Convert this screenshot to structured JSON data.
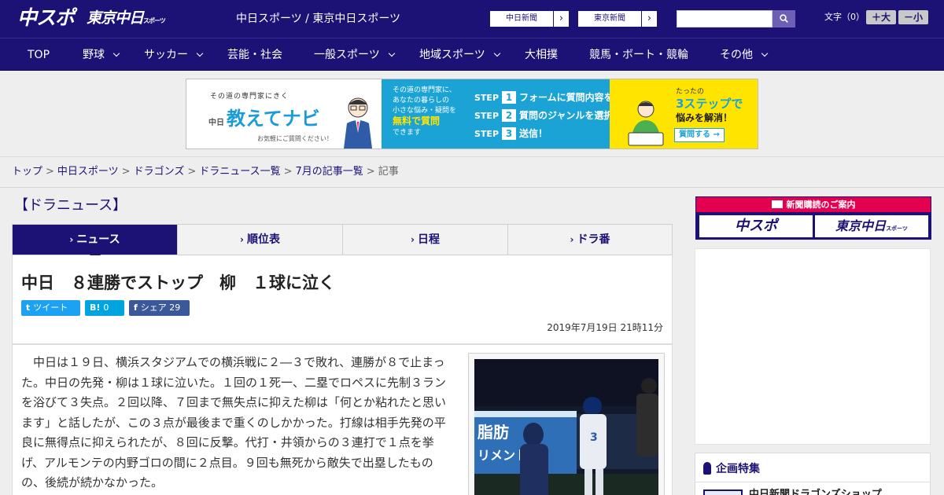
{
  "header": {
    "logo_main": "中スポ",
    "logo_tokyo": "東京中日",
    "logo_tokyo_suffix": "スポーツ",
    "site_caption": "中日スポーツ / 東京中日スポーツ",
    "paper_links": [
      "中日新聞",
      "東京新聞"
    ],
    "search_placeholder": "",
    "font_size_label": "文字（0）",
    "font_larger": "＋大",
    "font_smaller": "－小"
  },
  "nav": {
    "items": [
      {
        "label": "TOP",
        "dropdown": false
      },
      {
        "label": "野球",
        "dropdown": true
      },
      {
        "label": "サッカー",
        "dropdown": true
      },
      {
        "label": "芸能・社会",
        "dropdown": false
      },
      {
        "label": "一般スポーツ",
        "dropdown": true
      },
      {
        "label": "地域スポーツ",
        "dropdown": true
      },
      {
        "label": "大相撲",
        "dropdown": false
      },
      {
        "label": "競馬・ボート・競輪",
        "dropdown": false
      },
      {
        "label": "その他",
        "dropdown": true
      }
    ]
  },
  "ad_banner": {
    "tagline": "その道の専門家にきく",
    "brand_prefix": "中日",
    "brand": "教えてナビ",
    "sub": "お気軽にご質問ください！",
    "mid_lines": [
      "その道の専門家に、",
      "あなたの暮らしの",
      "小さな悩み・疑問を"
    ],
    "mid_highlight": "無料で質問",
    "mid_tail": "できます",
    "step_label": "STEP",
    "steps": [
      {
        "num": "1",
        "text": "フォームに質問内容を入力"
      },
      {
        "num": "2",
        "text": "質問のジャンルを選択"
      },
      {
        "num": "3",
        "text": "送信！"
      }
    ],
    "right_small": "たったの",
    "right_big": "3ステップで",
    "right_mid": "悩みを解消！",
    "cta": "質問する →"
  },
  "breadcrumb": {
    "items": [
      "トップ",
      "中日スポーツ",
      "ドラゴンズ",
      "ドラニュース一覧",
      "7月の記事一覧"
    ],
    "current": "記事",
    "separator": ">"
  },
  "main": {
    "section_title": "【ドラニュース】",
    "tabs": [
      {
        "label": "ニュース",
        "active": true
      },
      {
        "label": "順位表",
        "active": false
      },
      {
        "label": "日程",
        "active": false
      },
      {
        "label": "ドラ番",
        "active": false
      }
    ],
    "tab_mark": "›",
    "headline": "中日　８連勝でストップ　柳　１球に泣く",
    "share": {
      "tweet_icon": "t",
      "tweet": "ツイート",
      "hatena_icon": "B!",
      "hatena_count": "0",
      "facebook_icon": "f",
      "facebook_label": "シェア",
      "facebook_count": "29"
    },
    "date": "2019年7月19日 21時11分",
    "body": "中日は１９日、横浜スタジアムでの横浜戦に２―３で敗れ、連勝が８で止まった。中日の先発・柳は１球に泣いた。１回の１死一、二塁でロペスに先制３ランを浴びて３失点。２回以降、７回まで無失点に抑えた柳は「何とか粘れたと思います」と話したが、この３点が最後まで重くのしかかった。打線は相手先発の平良に無得点に抑えられたが、８回に反撃。代打・井領からの３連打で１点を挙げ、アルモンテの内野ゴロの間に２点目。９回も無死から敵失で出塁したものの、後続が続かなかった。",
    "photo_sign": "脂肪",
    "photo_sign2": "リメント!"
  },
  "sidebar": {
    "subscribe_title": "新聞購読のご案内",
    "sub_logo_a": "中スポ",
    "sub_logo_b": "東京中日",
    "sub_logo_b_suffix": "スポーツ",
    "feature_title": "企画特集",
    "feature_item": "中日新聞ドラゴンズショップ"
  },
  "colors": {
    "brand_navy": "#1c1275",
    "accent_red": "#e5004f",
    "twitter": "#1da1f2",
    "hatena": "#00a4de",
    "facebook": "#3b5998"
  }
}
